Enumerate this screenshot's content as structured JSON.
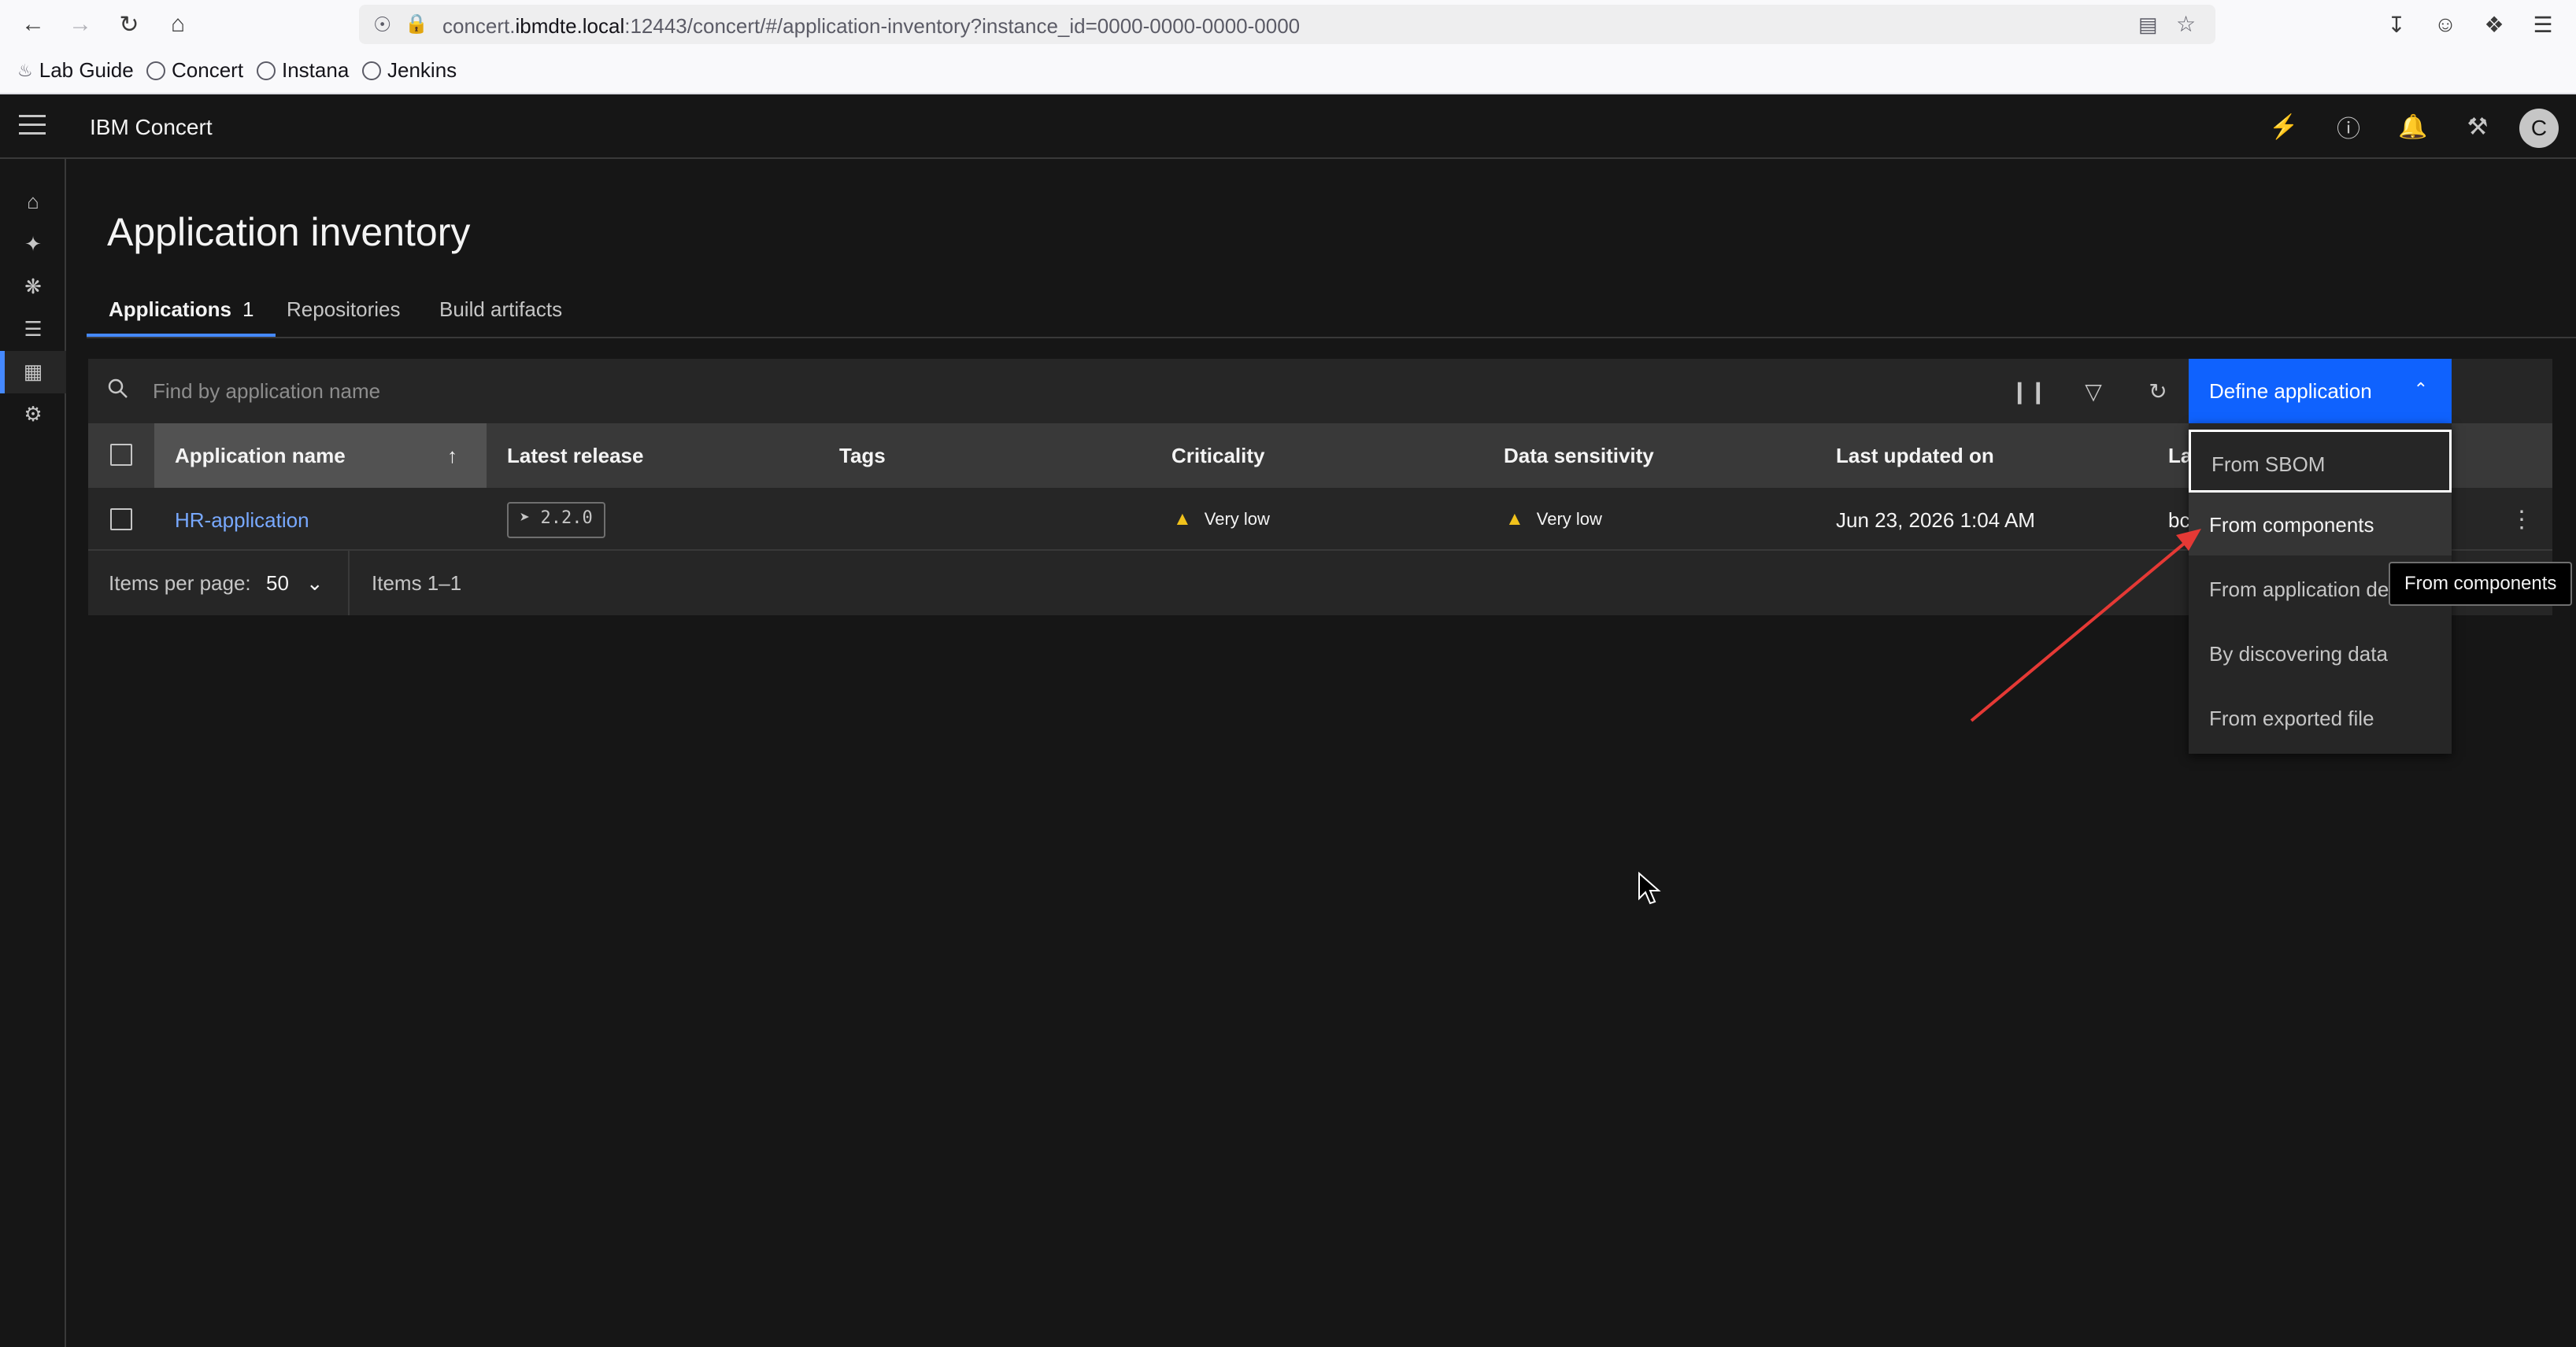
{
  "browser": {
    "url_prefix": "concert.",
    "url_host": "ibmdte.local",
    "url_rest": ":12443/concert/#/application-inventory?instance_id=0000-0000-0000-0000",
    "bookmarks": [
      "Lab Guide",
      "Concert",
      "Instana",
      "Jenkins"
    ]
  },
  "header": {
    "brand": "IBM Concert",
    "avatar_letter": "C"
  },
  "page": {
    "title": "Application inventory"
  },
  "tabs": [
    {
      "label": "Applications",
      "count": "1"
    },
    {
      "label": "Repositories"
    },
    {
      "label": "Build artifacts"
    }
  ],
  "toolbar": {
    "search_placeholder": "Find by application name",
    "define_label": "Define application"
  },
  "table": {
    "headers": [
      "Application name",
      "Latest release",
      "Tags",
      "Criticality",
      "Data sensitivity",
      "Last updated on",
      "La"
    ],
    "rows": [
      {
        "name": "HR-application",
        "release": "2.2.0",
        "tags": "",
        "criticality": "Very low",
        "sensitivity": "Very low",
        "updated": "Jun 23, 2026 1:04 AM",
        "last": "bc"
      }
    ]
  },
  "pager": {
    "items_per_page_label": "Items per page:",
    "per_page": "50",
    "range": "Items 1–1"
  },
  "menu": {
    "items": [
      "From SBOM",
      "From components",
      "From application def",
      "By discovering data",
      "From exported file"
    ]
  },
  "tooltip": "From components",
  "colors": {
    "primary": "#0f62fe",
    "link": "#78a9ff",
    "warning": "#f1c21b",
    "annotation_arrow": "#e53935"
  }
}
